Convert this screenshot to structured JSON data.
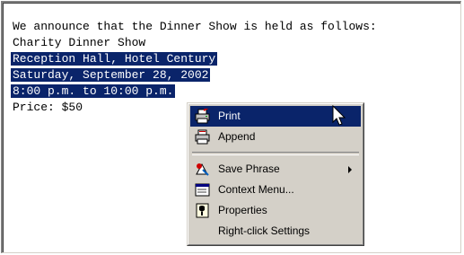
{
  "document": {
    "lines": [
      "We announce that the Dinner Show is held as follows:",
      "Charity Dinner Show",
      "Reception Hall, Hotel Century",
      "Saturday, September 28, 2002",
      "8:00 p.m. to 10:00 p.m.",
      "Price: $50"
    ],
    "selected_line_indices": [
      2,
      3,
      4
    ]
  },
  "context_menu": {
    "items": [
      {
        "label": "Print",
        "icon": "printer-icon",
        "highlighted": true
      },
      {
        "label": "Append",
        "icon": "append-printer-icon"
      },
      {
        "label": "Save Phrase",
        "icon": "save-phrase-icon",
        "submenu": true
      },
      {
        "label": "Context Menu...",
        "icon": "context-menu-icon"
      },
      {
        "label": "Properties",
        "icon": "properties-icon"
      },
      {
        "label": "Right-click Settings",
        "icon": ""
      }
    ]
  },
  "colors": {
    "selection": "#0a246a",
    "menu_background": "#d4d0c8"
  }
}
